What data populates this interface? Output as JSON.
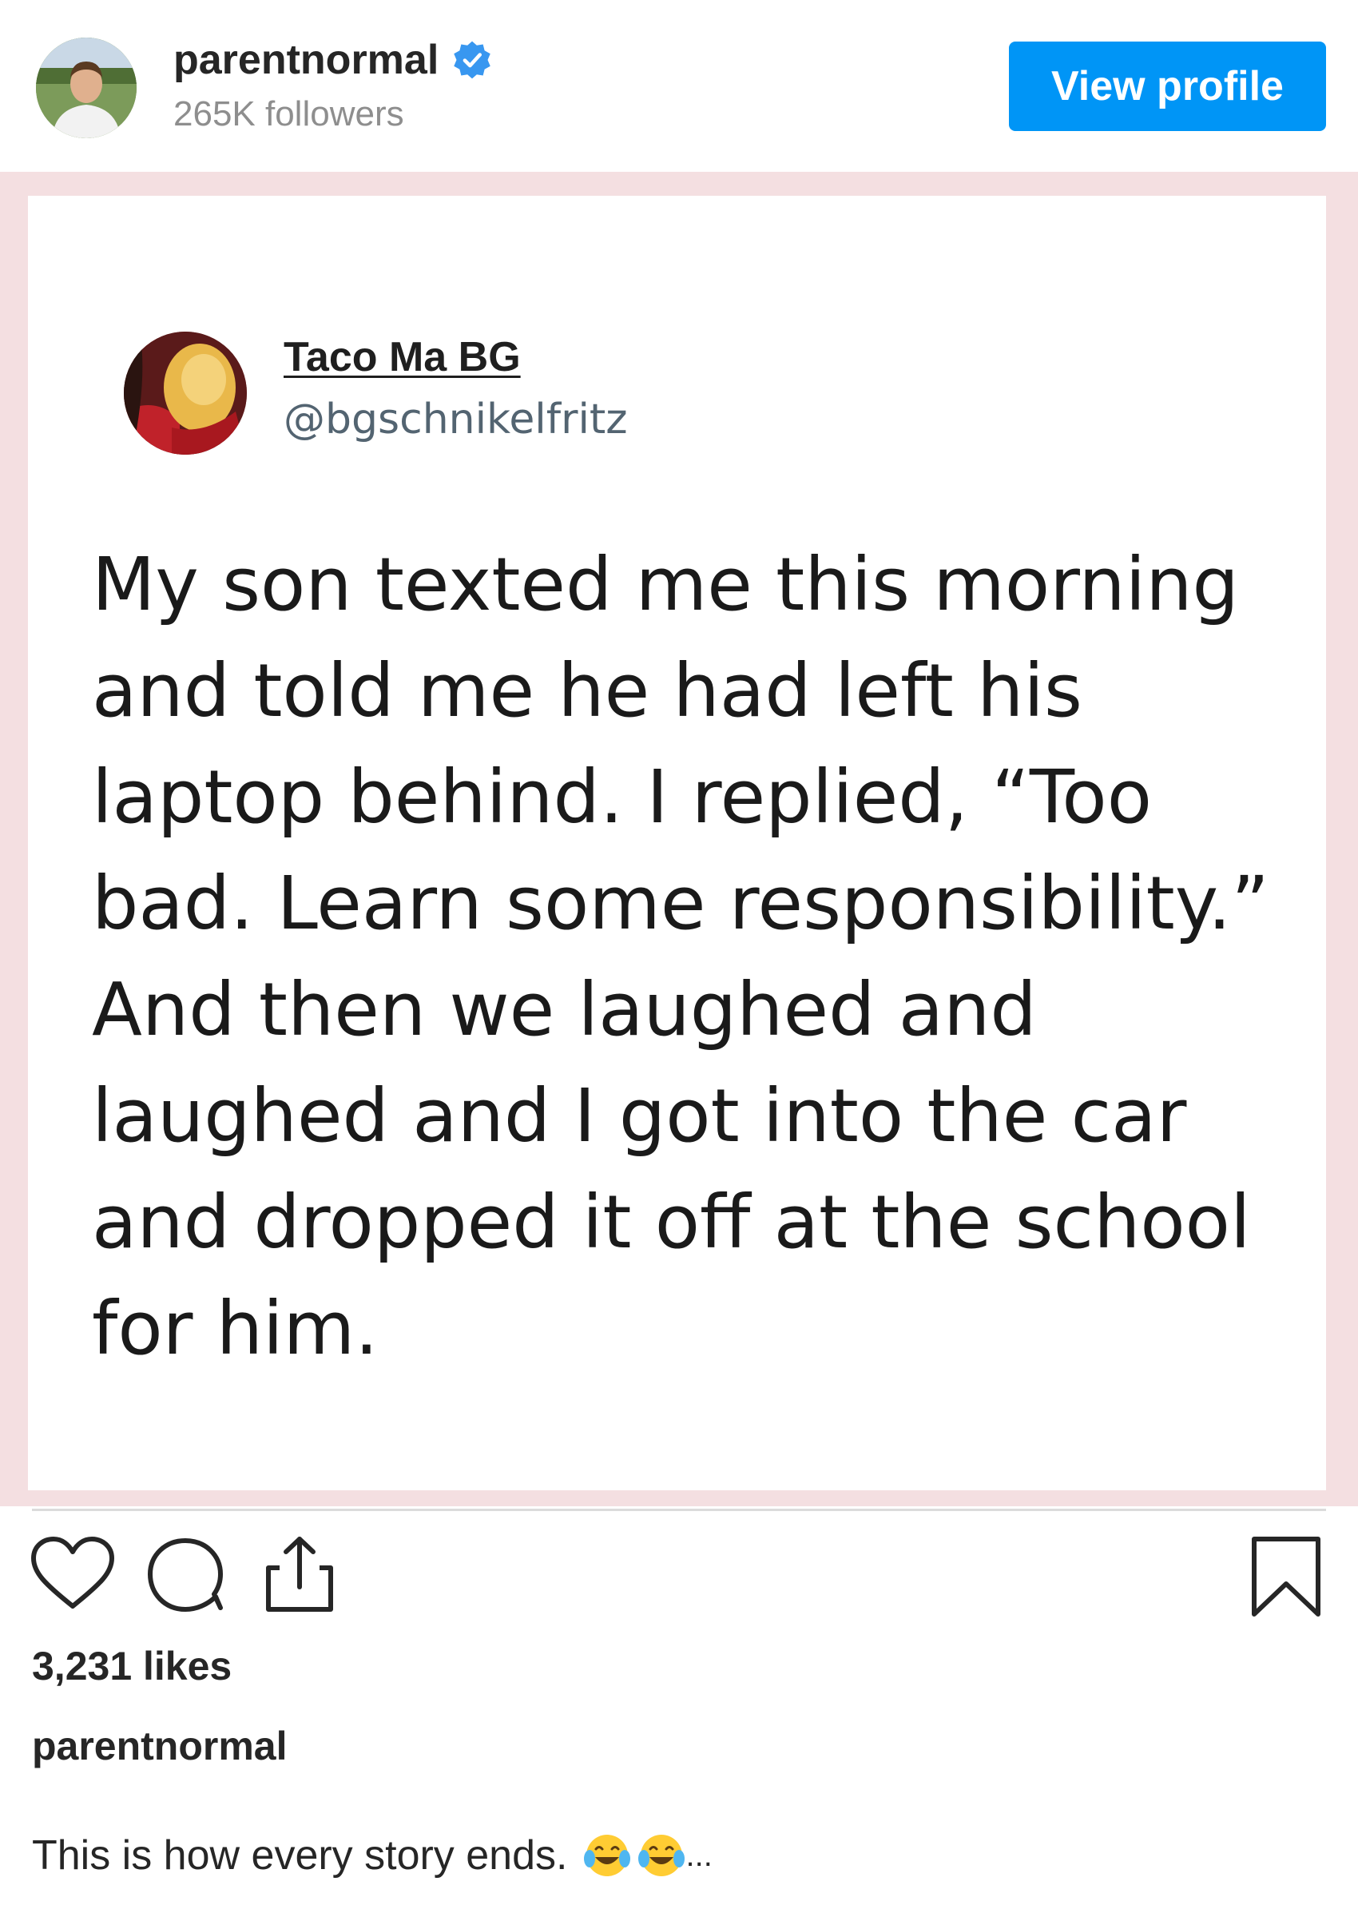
{
  "header": {
    "username": "parentnormal",
    "followers": "265K followers",
    "view_profile_label": "View profile"
  },
  "tweet": {
    "display_name": "Taco Ma BG",
    "handle": "@bgschnikelfritz",
    "lines": [
      "My son texted me this morning",
      "and told me he had left his",
      "laptop behind. I replied, “Too",
      "bad. Learn some responsibility.”",
      "And then we laughed and",
      "laughed and I got into the car",
      "and dropped it off at the school",
      "for him."
    ]
  },
  "post": {
    "likes": "3,231 likes",
    "caption_username": "parentnormal",
    "caption_text": "This is how every story ends.",
    "caption_more": "..."
  },
  "icons": {
    "verified": "verified-badge-icon",
    "heart": "heart-icon",
    "comment": "comment-icon",
    "share": "share-icon",
    "bookmark": "bookmark-icon",
    "emoji": "laughing-tears-emoji-icon"
  },
  "colors": {
    "accent": "#0095f6",
    "post_background": "#f4dfe1"
  }
}
